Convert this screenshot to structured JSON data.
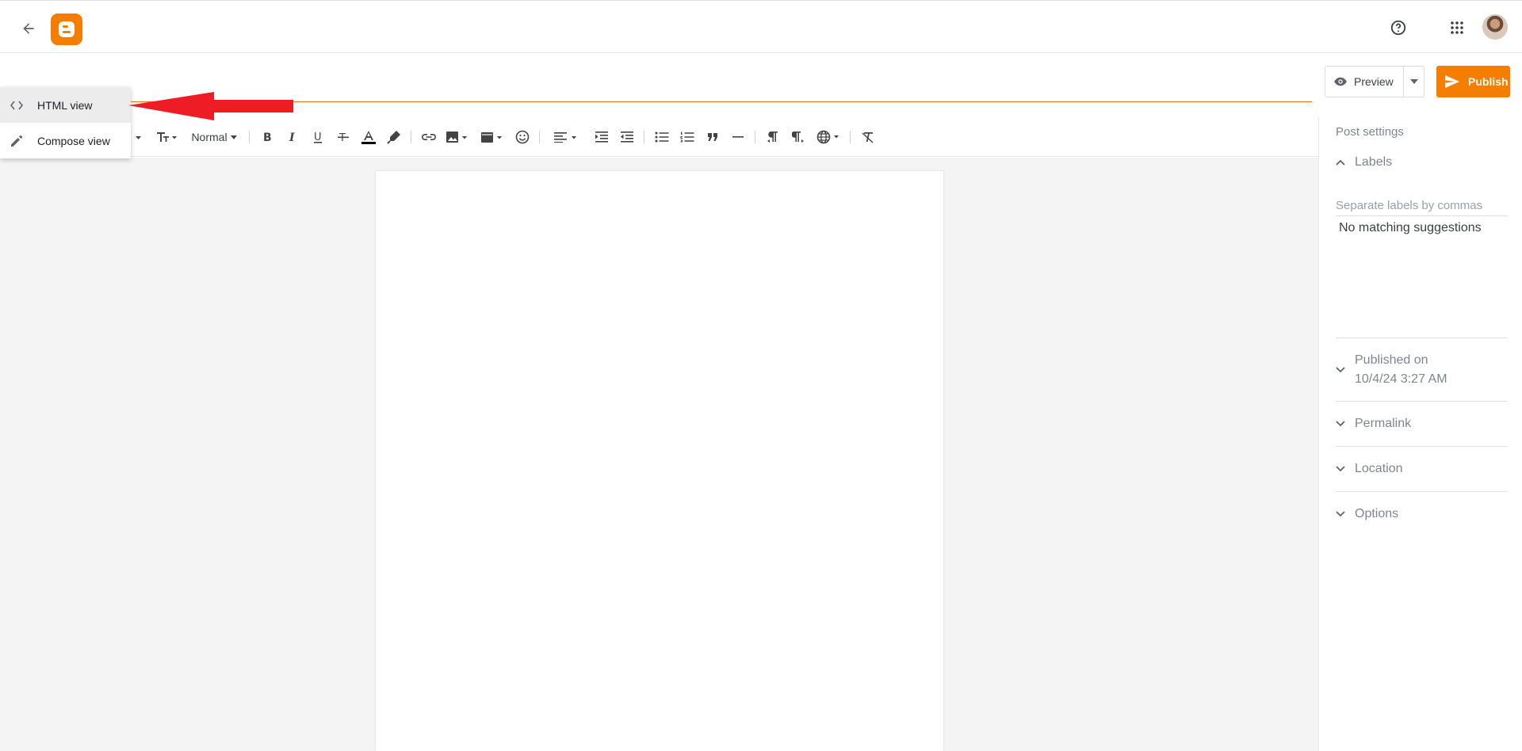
{
  "header": {
    "back_icon": "arrow-back-icon",
    "logo_icon": "blogger-logo-icon",
    "help_icon": "help-circle-icon",
    "apps_icon": "apps-grid-icon"
  },
  "actions": {
    "preview_label": "Preview",
    "publish_label": "Publish"
  },
  "view_menu": {
    "items": [
      {
        "label": "HTML view",
        "icon": "code-icon",
        "active": true
      },
      {
        "label": "Compose view",
        "icon": "pencil-icon",
        "active": false
      }
    ]
  },
  "toolbar": {
    "paragraph_style": "Normal"
  },
  "post_settings": {
    "title": "Post settings",
    "labels": {
      "heading": "Labels",
      "placeholder": "Separate labels by commas",
      "suggestions": "No matching suggestions"
    },
    "published_on": "Published on",
    "published_date": "10/4/24 3:27 AM",
    "permalink": "Permalink",
    "location": "Location",
    "options": "Options"
  },
  "colors": {
    "accent": "#f57d00",
    "title_underline": "#e8710a",
    "annotation_arrow": "#ee1c25"
  }
}
